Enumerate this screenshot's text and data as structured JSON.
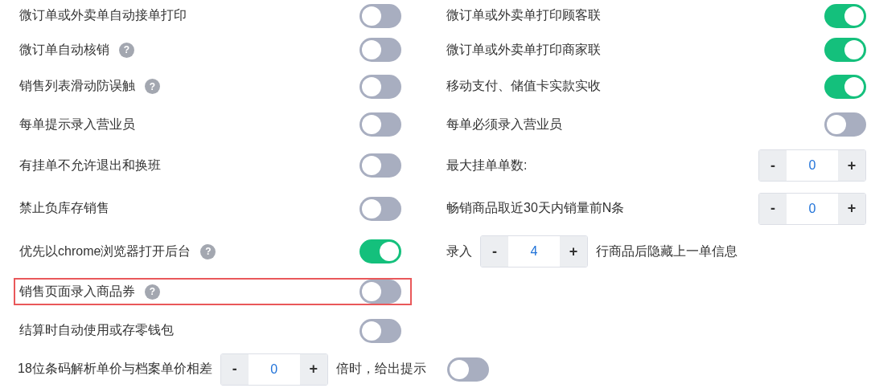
{
  "rows": [
    {
      "left": {
        "kind": "toggle",
        "label": "微订单或外卖单自动接单打印",
        "on": false,
        "highlighted": false
      },
      "right": {
        "kind": "toggle",
        "label": "微订单或外卖单打印顾客联",
        "on": true
      }
    },
    {
      "left": {
        "kind": "toggle",
        "label": "微订单自动核销",
        "help": "?",
        "on": false,
        "highlighted": false
      },
      "right": {
        "kind": "toggle",
        "label": "微订单或外卖单打印商家联",
        "on": true
      }
    },
    {
      "left": {
        "kind": "toggle",
        "label": "销售列表滑动防误触",
        "help": "?",
        "on": false,
        "highlighted": false
      },
      "right": {
        "kind": "toggle",
        "label": "移动支付、储值卡实款实收",
        "on": true
      }
    },
    {
      "left": {
        "kind": "toggle",
        "label": "每单提示录入营业员",
        "on": false,
        "highlighted": false
      },
      "right": {
        "kind": "toggle",
        "label": "每单必须录入营业员",
        "on": false
      }
    },
    {
      "left": {
        "kind": "toggle",
        "label": "有挂单不允许退出和换班",
        "on": false,
        "highlighted": false
      },
      "right": {
        "kind": "stepper",
        "label": "最大挂单单数:",
        "minus": "-",
        "value": "0",
        "plus": "+"
      }
    },
    {
      "left": {
        "kind": "toggle",
        "label": "禁止负库存销售",
        "on": false,
        "highlighted": false
      },
      "right": {
        "kind": "stepper",
        "label": "畅销商品取近30天内销量前N条",
        "minus": "-",
        "value": "0",
        "plus": "+"
      }
    },
    {
      "left": {
        "kind": "toggle",
        "label": "优先以chrome浏览器打开后台",
        "help": "?",
        "on": true,
        "highlighted": false
      },
      "right": {
        "kind": "inline_stepper",
        "prefix": "录入",
        "minus": "-",
        "value": "4",
        "plus": "+",
        "suffix": "行商品后隐藏上一单信息"
      }
    },
    {
      "left": {
        "kind": "toggle",
        "label": "销售页面录入商品券",
        "help": "?",
        "on": false,
        "highlighted": true
      }
    },
    {
      "left": {
        "kind": "toggle",
        "label": "结算时自动使用或存零钱包",
        "on": false,
        "highlighted": false
      }
    },
    {
      "full": {
        "kind": "inline_stepper",
        "prefix": "18位条码解析单价与档案单价相差",
        "minus": "-",
        "value": "0",
        "plus": "+",
        "suffix": "倍时，给出提示",
        "on": false
      }
    }
  ]
}
